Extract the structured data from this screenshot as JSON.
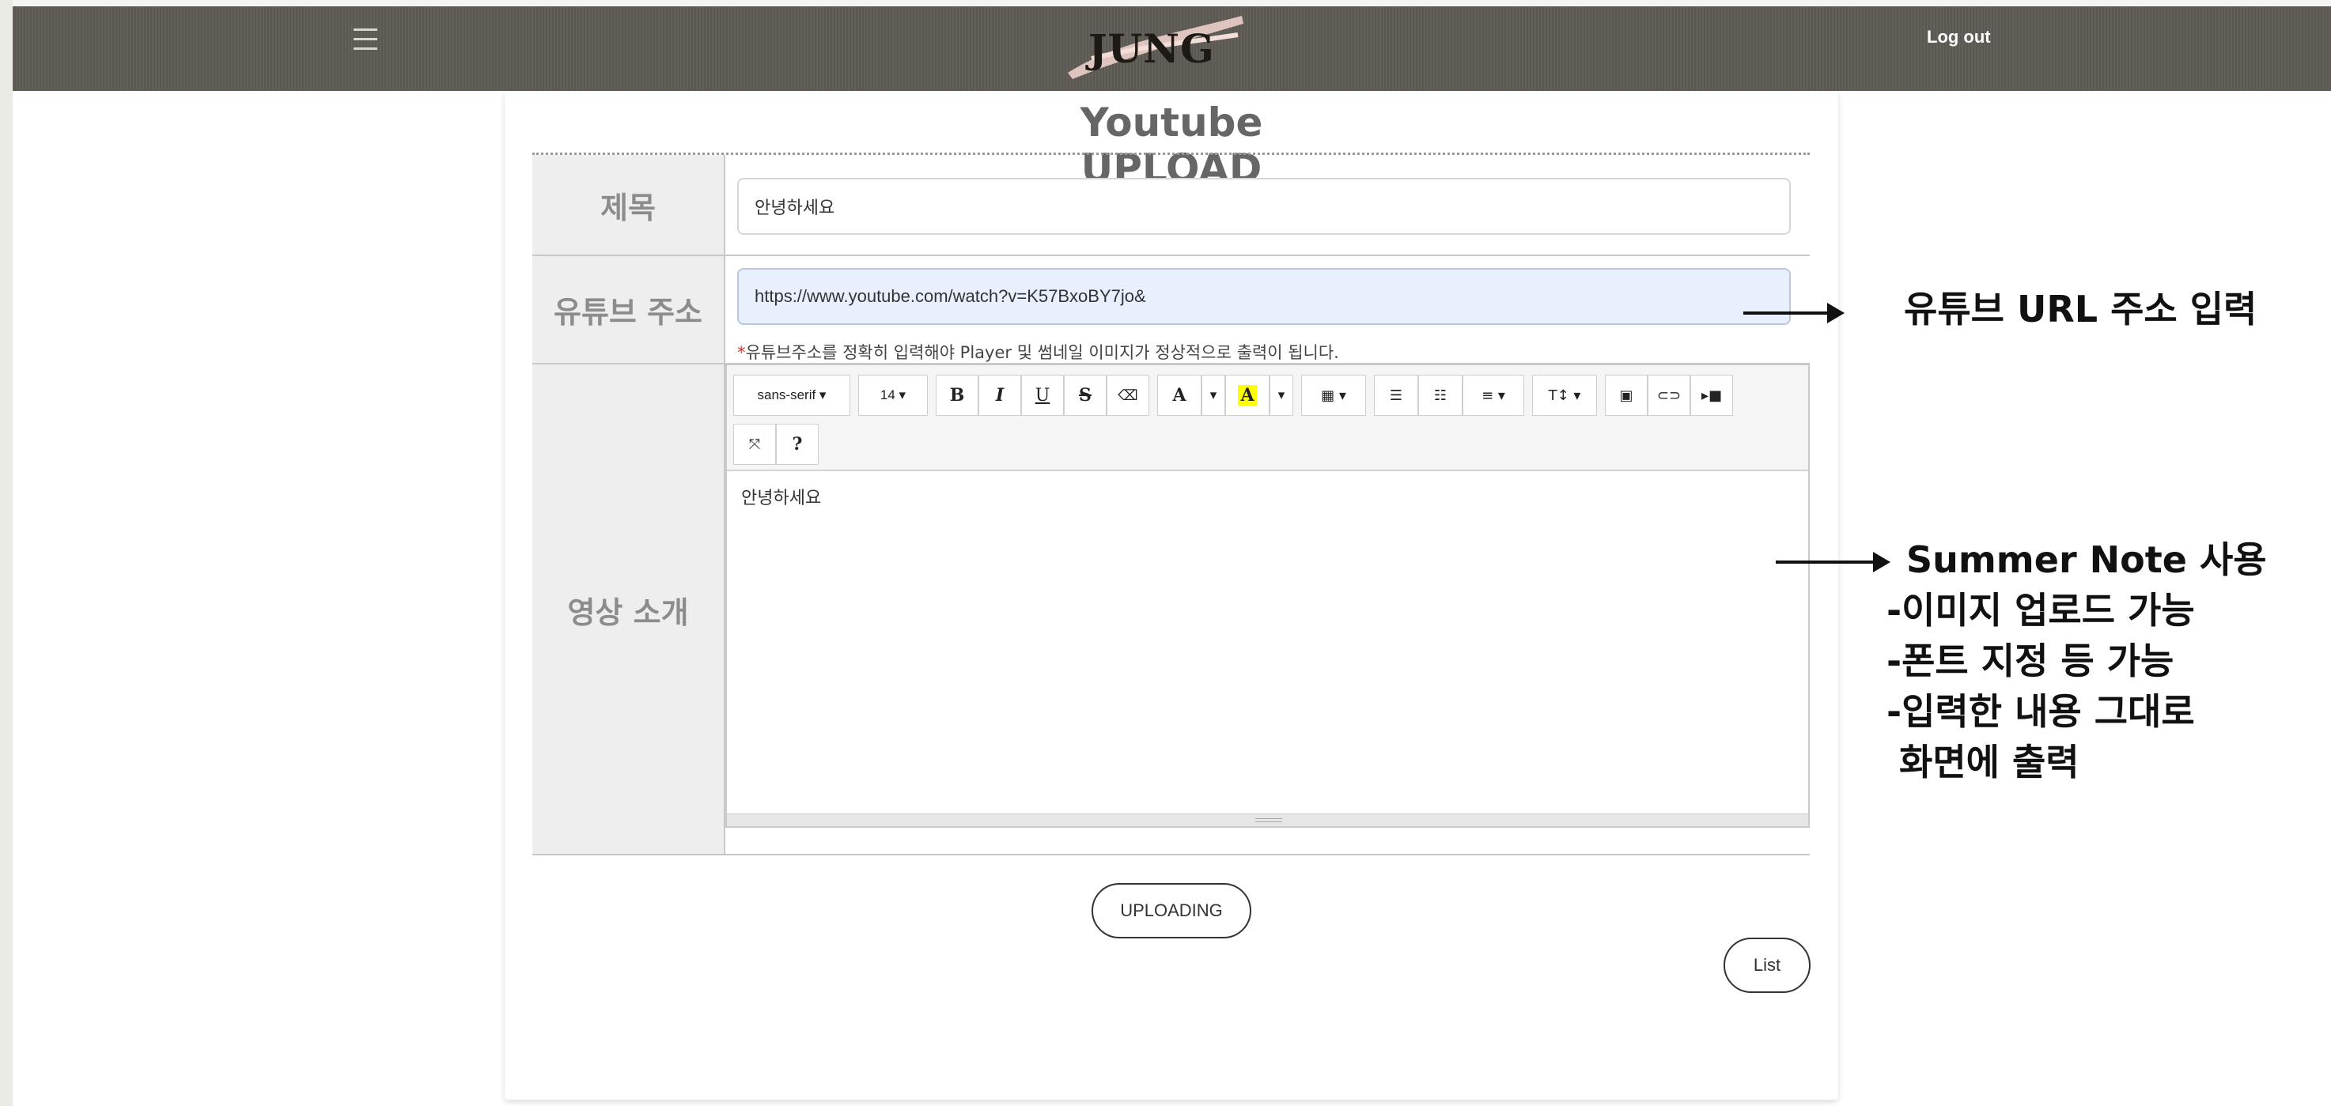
{
  "header": {
    "logo_text": "JUNG",
    "logout_label": "Log out",
    "menu_icon": "hamburger-menu-icon"
  },
  "page": {
    "title": "Youtube UPLOAD"
  },
  "form": {
    "title_label": "제목",
    "title_value": "안녕하세요",
    "url_label": "유튜브 주소",
    "url_value": "https://www.youtube.com/watch?v=K57BxoBY7jo&",
    "url_hint_star": "*",
    "url_hint": "유튜브주소를 정확히 입력해야 Player 및 썸네일 이미지가 정상적으로 출력이 됩니다.",
    "intro_label": "영상 소개",
    "editor_content": "안녕하세요"
  },
  "editor_toolbar": {
    "font_family": "sans-serif ▾",
    "font_size": "14 ▾",
    "bold": "B",
    "italic": "I",
    "underline": "U",
    "strikethrough": "S",
    "eraser": "⌫",
    "font_color": "A",
    "dropdown": "▾",
    "highlight": "A",
    "table": "▦ ▾",
    "ul": "☰",
    "ol": "☷",
    "align": "≡ ▾",
    "line_height": "T↕ ▾",
    "picture": "▣",
    "link": "⊂⊃",
    "video": "▸■",
    "fullscreen": "⤧",
    "help": "?"
  },
  "buttons": {
    "upload": "UPLOADING",
    "list": "List"
  },
  "annotations": {
    "url_note": "유튜브 URL 주소 입력",
    "editor_note_1": "Summer Note 사용",
    "editor_note_2": "-이미지 업로드 가능",
    "editor_note_3": "-폰트 지정 등 가능",
    "editor_note_4": "-입력한 내용 그대로",
    "editor_note_5": " 화면에 출력"
  }
}
